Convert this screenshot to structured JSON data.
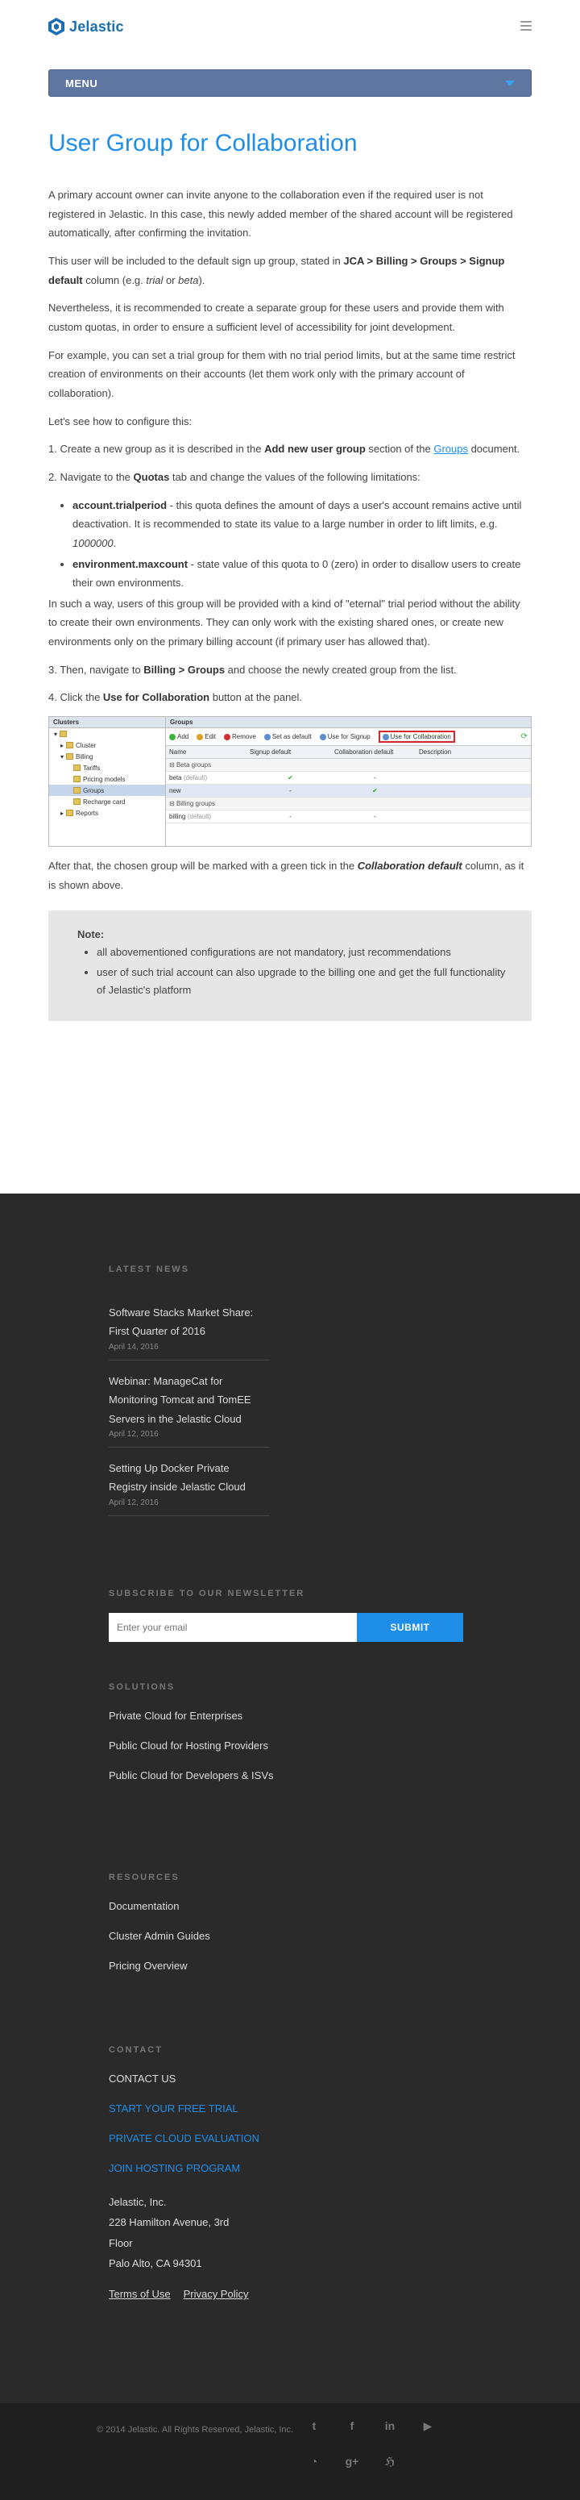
{
  "header": {
    "logo_text": "Jelastic",
    "menu_label": "MENU"
  },
  "article": {
    "title": "User Group for Collaboration",
    "p1": "A primary account owner can invite anyone to the collaboration even if the required user is not registered in Jelastic. In this case, this newly added member of the shared account will be registered automatically, after confirming the invitation.",
    "p2_pre": "This user will be included to the default sign up group, stated in ",
    "p2_bold": "JCA > Billing > Groups > Signup default",
    "p2_mid": " column (e.g. ",
    "p2_ital": "trial",
    "p2_or": " or ",
    "p2_ital2": "beta",
    "p2_end": ").",
    "p3": "Nevertheless, it is recommended to create a separate group for these users and provide them with custom quotas, in order to ensure a sufficient level of accessibility for joint development.",
    "p4": "For example, you can set a trial group for them with no trial period limits, but at the same time restrict creation of environments on their accounts (let them work only with the primary account of collaboration).",
    "p5": "Let's see how to configure this:",
    "s1_pre": "1. Create a new group as it is described in the ",
    "s1_bold": "Add new user group",
    "s1_mid": " section of the ",
    "s1_link": "Groups",
    "s1_end": " document.",
    "s2_pre": "2. Navigate to the ",
    "s2_bold": "Quotas",
    "s2_end": " tab and change the values of the following limitations:",
    "q1_name": "account.trialperiod",
    "q1_text": " - this quota defines the amount of days a user's account remains active until deactivation. It is recommended to state its value to a large number in order to lift limits, e.g. ",
    "q1_val": "1000000",
    "q1_end": ".",
    "q2_name": "environment.maxcount",
    "q2_text": " - state value of this quota to 0 (zero) in order to disallow users to create their own environments.",
    "p6": "In such a way, users of this group will be provided with a kind of \"eternal\" trial period without the ability to create their own environments. They can only work with the existing shared ones, or create new environments only on the primary billing account (if primary user has allowed that).",
    "s3_pre": "3. Then, navigate to ",
    "s3_bold": "Billing > Groups",
    "s3_end": " and choose the newly created group from the list.",
    "s4_pre": "4. Click the ",
    "s4_bold": "Use for Collaboration",
    "s4_end": " button at the panel.",
    "p7_pre": "After that, the chosen group will be marked with a green tick in the ",
    "p7_bi": "Collaboration default",
    "p7_end": " column, as it is shown above.",
    "note_title": "Note:",
    "note_items": [
      "all abovementioned configurations are not mandatory, just recommendations",
      "user of such trial account can also upgrade to the billing one and get the full functionality of Jelastic's platform"
    ]
  },
  "screenshot": {
    "left_header": "Clusters",
    "tree": [
      "",
      "Cluster",
      "Billing",
      "Tariffs",
      "Pricing models",
      "Groups",
      "Recharge card",
      "Reports"
    ],
    "right_header": "Groups",
    "tools": [
      "Add",
      "Edit",
      "Remove",
      "Set as default",
      "Use for Signup",
      "Use for Collaboration"
    ],
    "columns": [
      "Name",
      "Signup default",
      "Collaboration default",
      "Description"
    ],
    "rows": {
      "g1": "Beta groups",
      "r1_name": "beta",
      "r1_tag": "(default)",
      "r2_name": "new",
      "g2": "Billing groups",
      "r3_name": "billing",
      "r3_tag": "(default)",
      "tick": "✔",
      "dash": "-"
    }
  },
  "footer": {
    "news_heading": "LATEST NEWS",
    "news": [
      {
        "title": "Software Stacks Market Share: First Quarter of 2016",
        "date": "April 14, 2016"
      },
      {
        "title": "Webinar: ManageCat for Monitoring Tomcat and TomEE Servers in the Jelastic Cloud",
        "date": "April 12, 2016"
      },
      {
        "title": "Setting Up Docker Private Registry inside Jelastic Cloud",
        "date": "April 12, 2016"
      }
    ],
    "subscribe_heading": "SUBSCRIBE TO OUR NEWSLETTER",
    "email_placeholder": "Enter your email",
    "submit_label": "SUBMIT",
    "solutions_heading": "SOLUTIONS",
    "solutions": [
      "Private Cloud for Enterprises",
      "Public Cloud for Hosting Providers",
      "Public Cloud for Developers & ISVs"
    ],
    "resources_heading": "RESOURCES",
    "resources": [
      "Documentation",
      "Cluster Admin Guides",
      "Pricing Overview"
    ],
    "contact_heading": "CONTACT",
    "contact_us": "CONTACT US",
    "contact_links": [
      "START YOUR FREE TRIAL",
      "PRIVATE CLOUD EVALUATION",
      "JOIN HOSTING PROGRAM"
    ],
    "address": [
      "Jelastic, Inc.",
      "228 Hamilton Avenue, 3rd",
      "Floor",
      "Palo Alto, CA 94301"
    ],
    "terms": "Terms of Use",
    "privacy": "Privacy Policy",
    "copyright": "© 2014 Jelastic. All Rights Reserved, Jelastic, Inc.",
    "social": {
      "twitter": "t",
      "facebook": "f",
      "linkedin": "in",
      "youtube": "▶",
      "github": "◔",
      "googleplus": "g+",
      "habr": "ℌ"
    }
  }
}
